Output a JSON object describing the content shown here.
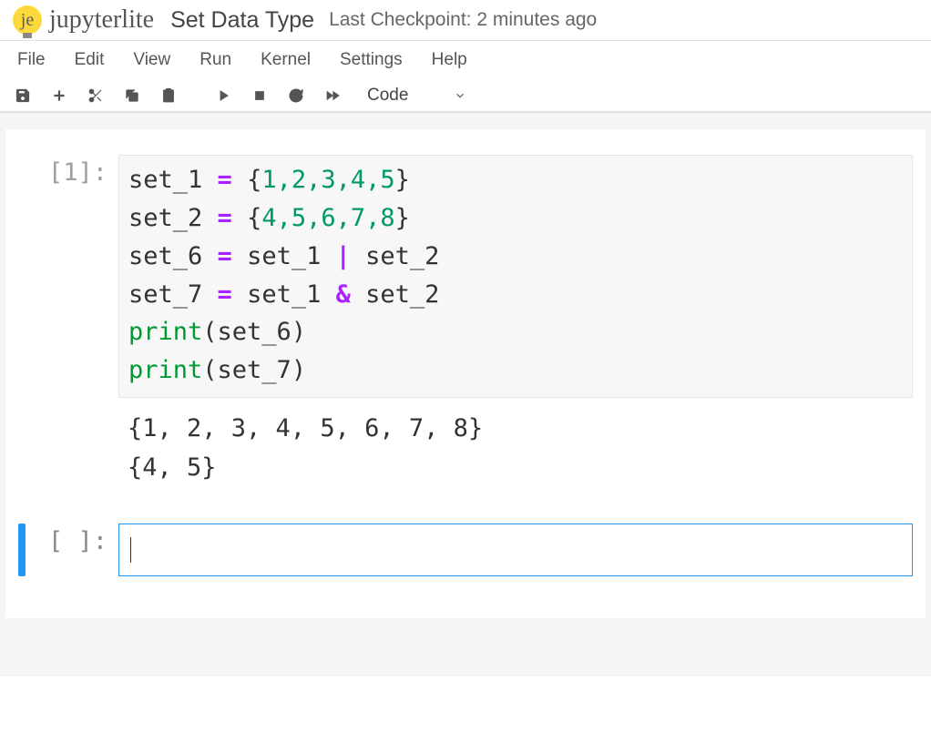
{
  "header": {
    "logo_text_short": "je",
    "logo_text": "jupyterlite",
    "title": "Set Data Type",
    "checkpoint": "Last Checkpoint: 2 minutes ago"
  },
  "menu": {
    "file": "File",
    "edit": "Edit",
    "view": "View",
    "run": "Run",
    "kernel": "Kernel",
    "settings": "Settings",
    "help": "Help"
  },
  "toolbar": {
    "cell_type": "Code"
  },
  "cells": [
    {
      "exec_count": "[1]:",
      "code": {
        "line1_lhs": "set_1 ",
        "line1_eq": "=",
        "line1_sp": " {",
        "line1_nums": "1,2,3,4,5",
        "line1_close": "}",
        "line2_lhs": "set_2 ",
        "line2_eq": "=",
        "line2_sp": " {",
        "line2_nums": "4,5,6,7,8",
        "line2_close": "}",
        "line3_lhs": "set_6 ",
        "line3_eq": "=",
        "line3_rhs_a": " set_1 ",
        "line3_op": "|",
        "line3_rhs_b": " set_2",
        "line4_lhs": "set_7 ",
        "line4_eq": "=",
        "line4_rhs_a": " set_1 ",
        "line4_op": "&",
        "line4_rhs_b": " set_2",
        "line5_fn": "print",
        "line5_arg": "(set_6)",
        "line6_fn": "print",
        "line6_arg": "(set_7)"
      },
      "output_line1": "{1, 2, 3, 4, 5, 6, 7, 8}",
      "output_line2": "{4, 5}"
    },
    {
      "exec_count": "[ ]:",
      "code_text": ""
    }
  ]
}
